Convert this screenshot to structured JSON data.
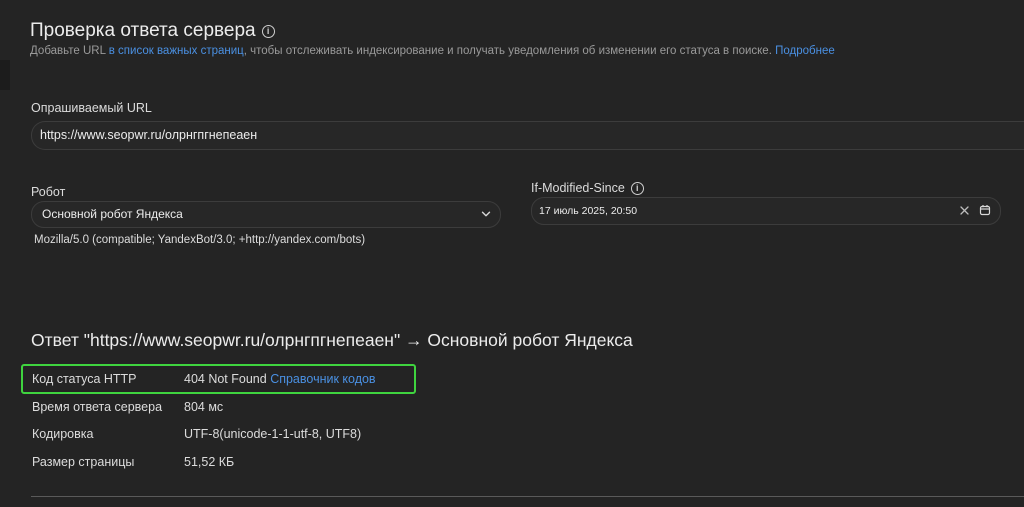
{
  "header": {
    "title": "Проверка ответа сервера",
    "info_icon": "info-icon",
    "subtitle_before": "Добавьте URL ",
    "subtitle_link": "в список важных страниц",
    "subtitle_after": ", чтобы отслеживать индексирование и получать уведомления об изменении его статуса в поиске. ",
    "more_link": "Подробнее"
  },
  "form": {
    "url_label": "Опрашиваемый URL",
    "url_value": "https://www.seopwr.ru/олрнгпгнепеаен",
    "robot_label": "Робот",
    "robot_selected": "Основной робот Яндекса",
    "user_agent": "Mozilla/5.0 (compatible; YandexBot/3.0; +http://yandex.com/bots)",
    "ims_label": "If-Modified-Since",
    "ims_value": "17 июль 2025, 20:50",
    "icons": {
      "chevron": "chevron-down-icon",
      "clear": "close-icon",
      "calendar": "calendar-icon"
    }
  },
  "result": {
    "title": "Ответ \"https://www.seopwr.ru/олрнгпгнепеаен\" → Основной робот Яндекса",
    "rows": [
      {
        "label": "Код статуса HTTP",
        "value": "404 Not Found",
        "link": "Справочник кодов"
      },
      {
        "label": "Время ответа сервера",
        "value": "804 мс"
      },
      {
        "label": "Кодировка",
        "value": "UTF-8(unicode-1-1-utf-8, UTF8)"
      },
      {
        "label": "Размер страницы",
        "value": "51,52 КБ"
      }
    ]
  },
  "colors": {
    "background": "#242424",
    "link": "#4a90e2",
    "highlight": "#3fd43f"
  }
}
